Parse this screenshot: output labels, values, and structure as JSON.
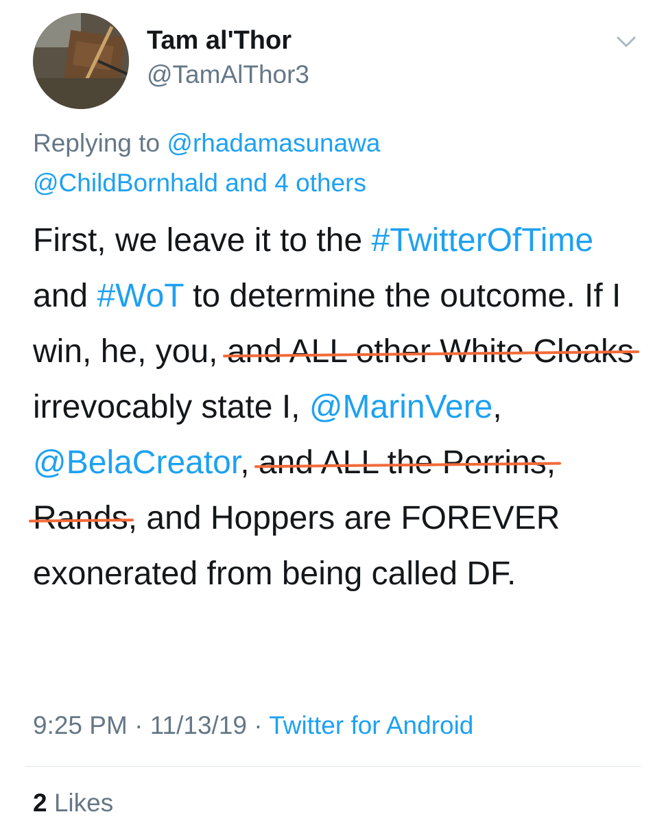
{
  "user": {
    "name": "Tam al'Thor",
    "handle": "@TamAlThor3"
  },
  "reply": {
    "prefix": "Replying to",
    "mention1": "@rhadamasunawa",
    "mention2": "@ChildBornhald",
    "suffix_and": "and",
    "others": "4 others"
  },
  "tweet": {
    "t1": "First, we leave it to the",
    "hash1": "#TwitterOfTime",
    "t2": "and",
    "hash2": "#WoT",
    "t3": "to determine the outcome. If I win, he, you,",
    "strike1": "and ALL other White Cloaks",
    "t4": "irrevocably state I,",
    "mention1": "@MarinVere",
    "t5": ",",
    "mention2": "@BelaCreator",
    "t6": ",",
    "strike2": "and ALL the Perrins,",
    "strike3": "Rands",
    "t7": ", and Hoppers are FOREVER exonerated from being called DF."
  },
  "meta": {
    "time": "9:25 PM",
    "sep1": "·",
    "date": "11/13/19",
    "sep2": "·",
    "source": "Twitter for Android"
  },
  "stats": {
    "likes_count": "2",
    "likes_label": "Likes"
  },
  "icons": {
    "avatar": "profile-photo",
    "more": "chevron-down-icon"
  },
  "colors": {
    "link": "#1da1f2",
    "secondary": "#657786",
    "primary": "#14171a",
    "strike": "#f26a3a"
  }
}
